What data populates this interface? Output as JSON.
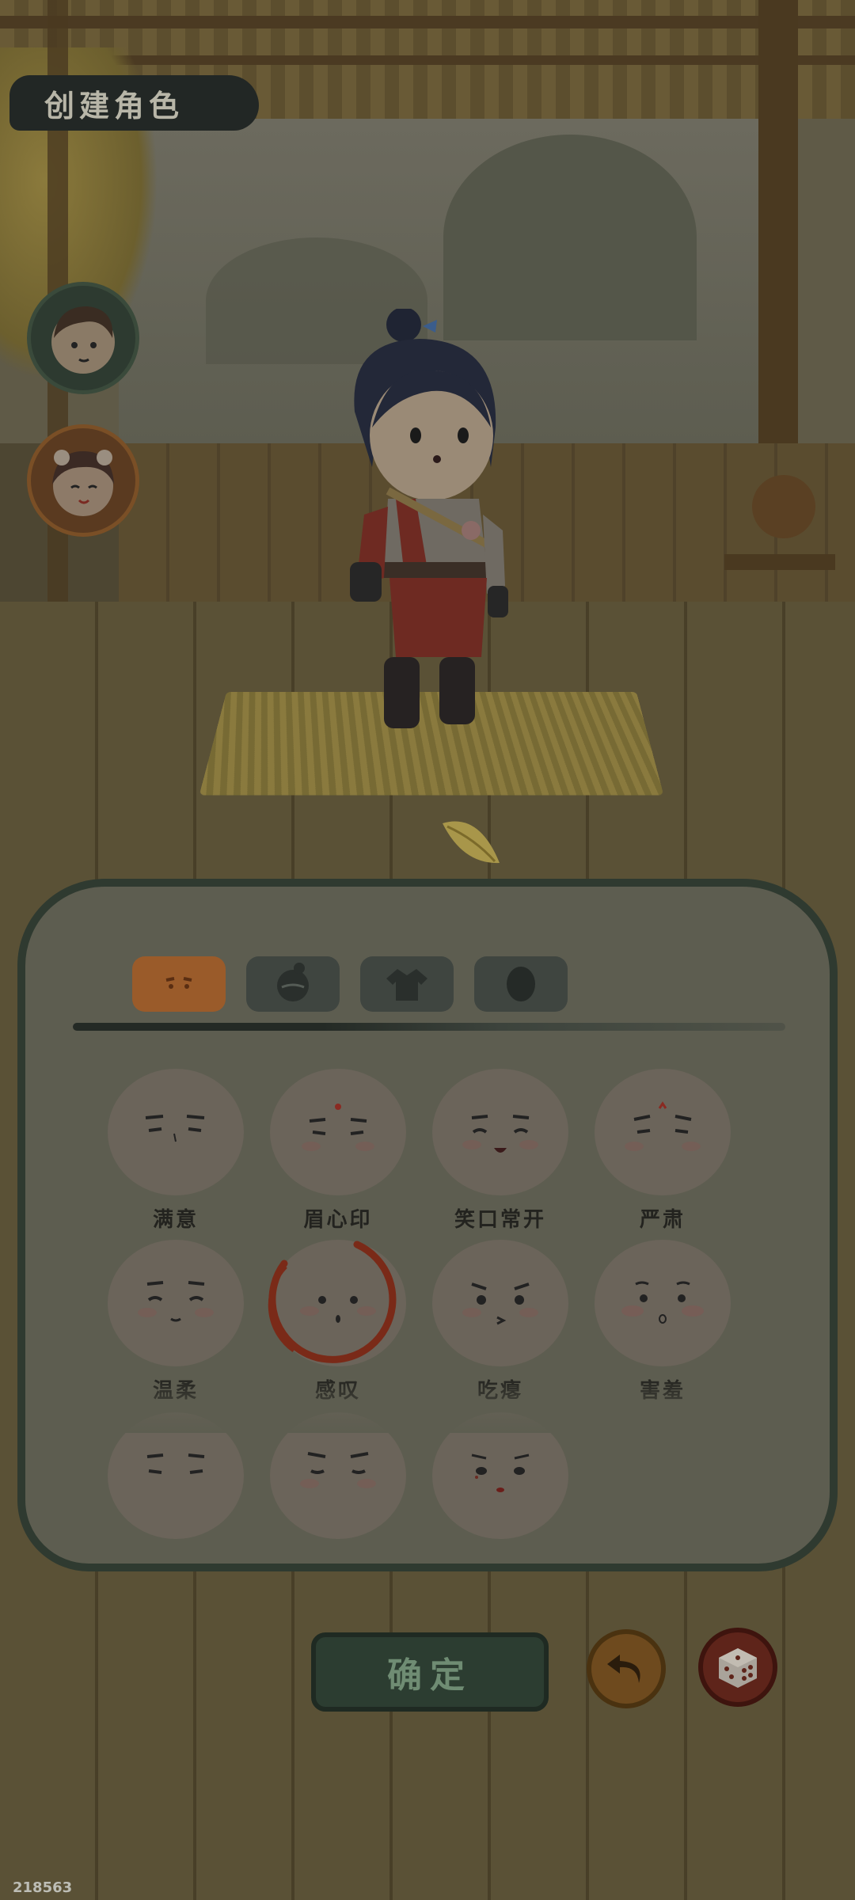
{
  "header": {
    "title": "创建角色"
  },
  "side_avatars": [
    {
      "name": "male-character-avatar"
    },
    {
      "name": "female-character-avatar"
    }
  ],
  "tabs": [
    {
      "icon": "expression-face-icon",
      "active": true
    },
    {
      "icon": "hairstyle-icon",
      "active": false
    },
    {
      "icon": "clothing-icon",
      "active": false
    },
    {
      "icon": "skin-tone-icon",
      "active": false
    }
  ],
  "expressions": [
    {
      "label": "满意",
      "selected": false
    },
    {
      "label": "眉心印",
      "selected": false
    },
    {
      "label": "笑口常开",
      "selected": false
    },
    {
      "label": "严肃",
      "selected": false
    },
    {
      "label": "温柔",
      "selected": false
    },
    {
      "label": "感叹",
      "selected": true
    },
    {
      "label": "吃瘪",
      "selected": false
    },
    {
      "label": "害羞",
      "selected": false
    },
    {
      "label": "",
      "selected": false
    },
    {
      "label": "",
      "selected": false
    },
    {
      "label": "",
      "selected": false
    }
  ],
  "actions": {
    "confirm_label": "确定",
    "undo_icon": "undo-icon",
    "random_icon": "dice-icon"
  },
  "corner_id": "218563",
  "colors": {
    "accent_orange": "#9a5b2a",
    "selected_ring": "#7a2a18",
    "panel_border": "#2f3a30",
    "confirm_bg": "#2c3d31"
  }
}
